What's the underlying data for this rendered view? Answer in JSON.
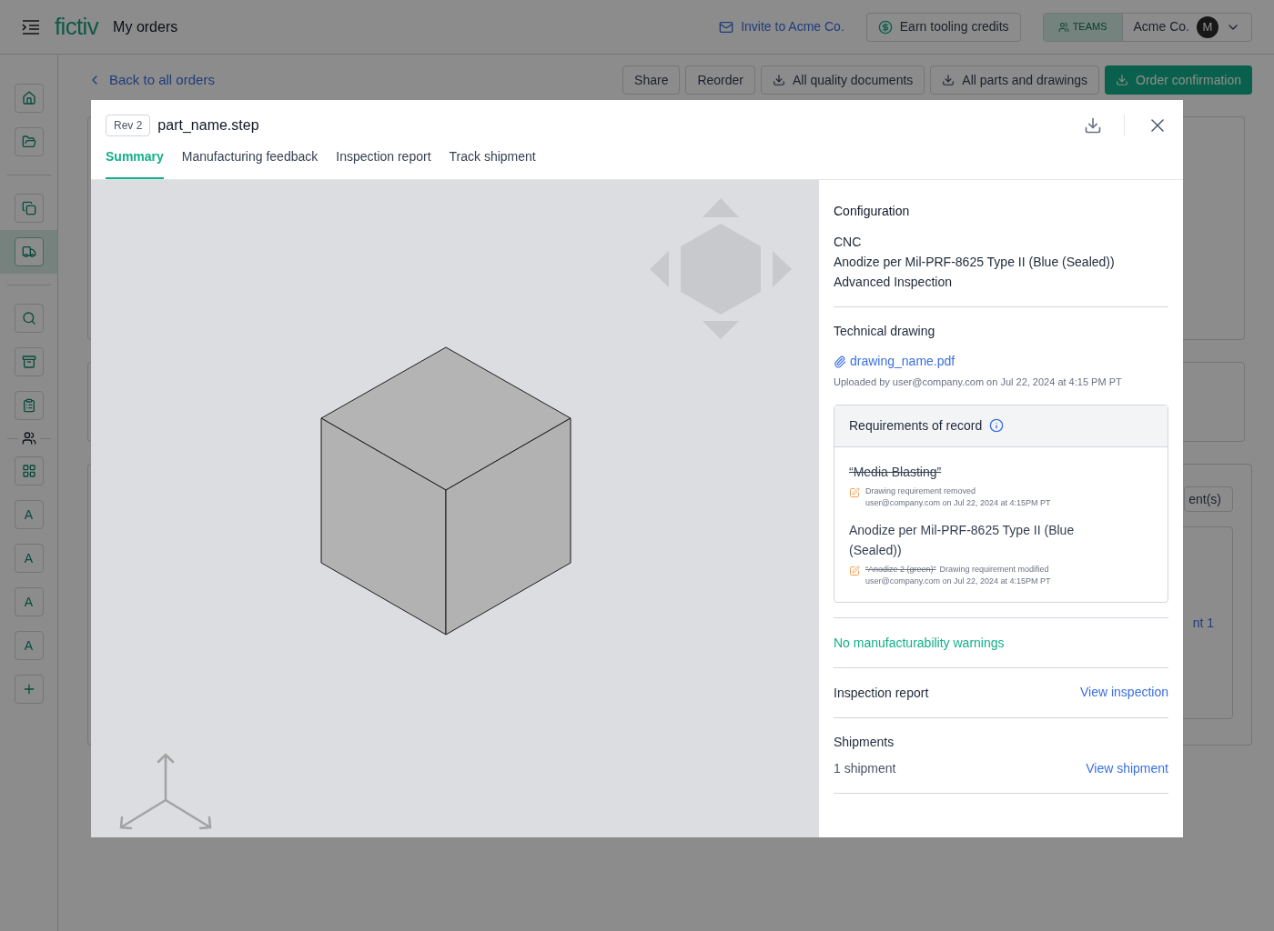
{
  "header": {
    "logo": "fictiv",
    "title": "My orders",
    "invite": "Invite to Acme Co.",
    "credits": "Earn tooling credits",
    "teams": "TEAMS",
    "org": "Acme Co.",
    "avatar": "M"
  },
  "sidebar": {
    "items": [
      {
        "kind": "icon",
        "selected": false
      },
      {
        "kind": "icon",
        "selected": false
      },
      {
        "kind": "divider"
      },
      {
        "kind": "icon",
        "selected": false
      },
      {
        "kind": "icon",
        "selected": true
      },
      {
        "kind": "divider"
      },
      {
        "kind": "icon",
        "selected": false
      },
      {
        "kind": "icon",
        "selected": false
      },
      {
        "kind": "icon",
        "selected": false
      },
      {
        "kind": "team-divider"
      },
      {
        "kind": "icon",
        "selected": false
      },
      {
        "kind": "letter",
        "label": "A",
        "selected": false
      },
      {
        "kind": "letter",
        "label": "A",
        "selected": false
      },
      {
        "kind": "letter",
        "label": "A",
        "selected": false
      },
      {
        "kind": "letter",
        "label": "A",
        "selected": false
      },
      {
        "kind": "add",
        "selected": false
      }
    ]
  },
  "page": {
    "back_link": "Back to all orders",
    "actions": [
      {
        "label": "Share",
        "download": false,
        "primary": false
      },
      {
        "label": "Reorder",
        "download": false,
        "primary": false
      },
      {
        "label": "All quality documents",
        "download": true,
        "primary": false
      },
      {
        "label": "All parts and drawings",
        "download": true,
        "primary": false
      },
      {
        "label": "Order confirmation",
        "download": true,
        "primary": true
      }
    ],
    "side_button": "ent(s)",
    "side_link": "nt 1"
  },
  "modal": {
    "revision": "Rev 2",
    "file_name": "part_name.step",
    "tabs": [
      {
        "label": "Summary",
        "selected": true
      },
      {
        "label": "Manufacturing feedback",
        "selected": false
      },
      {
        "label": "Inspection report",
        "selected": false
      },
      {
        "label": "Track shipment",
        "selected": false
      }
    ],
    "configuration": {
      "heading": "Configuration",
      "lines": [
        "CNC",
        "Anodize per Mil-PRF-8625 Type II (Blue (Sealed))",
        "Advanced Inspection"
      ]
    },
    "technical_drawing": {
      "heading": "Technical drawing",
      "file": "drawing_name.pdf",
      "uploaded": "Uploaded by user@company.com on Jul 22, 2024 at 4:15 PM PT"
    },
    "requirements": {
      "title": "Requirements of record",
      "items": [
        {
          "text": "“Media Blasting”",
          "removed": true,
          "note": "Drawing requirement removed",
          "meta": "user@company.com on Jul 22, 2024 at 4:15PM PT"
        },
        {
          "text": "Anodize per Mil-PRF-8625 Type II (Blue (Sealed))",
          "removed": false,
          "old_value": "“Anodize 2 (green)”",
          "note": "Drawing requirement modified",
          "meta": "user@company.com on Jul 22, 2024 at 4:15PM PT"
        }
      ]
    },
    "manufacturability": "No manufacturability warnings",
    "inspection": {
      "label": "Inspection report",
      "link": "View inspection"
    },
    "shipments": {
      "heading": "Shipments",
      "count": "1 shipment",
      "link": "View shipment"
    }
  }
}
